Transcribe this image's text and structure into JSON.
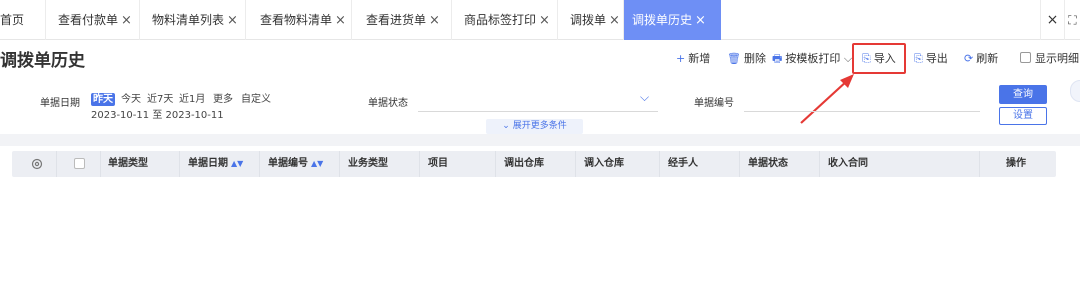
{
  "tabs": [
    {
      "label": "首页",
      "closable": false,
      "active": false
    },
    {
      "label": "查看付款单",
      "closable": true,
      "active": false
    },
    {
      "label": "物料清单列表",
      "closable": true,
      "active": false
    },
    {
      "label": "查看物料清单",
      "closable": true,
      "active": false
    },
    {
      "label": "查看进货单",
      "closable": true,
      "active": false
    },
    {
      "label": "商品标签打印",
      "closable": true,
      "active": false
    },
    {
      "label": "调拨单",
      "closable": true,
      "active": false
    },
    {
      "label": "调拨单历史",
      "closable": true,
      "active": true
    }
  ],
  "tab_close_glyph": "×",
  "tab_close_all": "×",
  "tab_fullscreen": "⛶",
  "page": {
    "title": "调拨单历史"
  },
  "toolbar": {
    "add": {
      "icon": "+",
      "label": "新增"
    },
    "delete": {
      "icon": "🗑",
      "label": "删除"
    },
    "print": {
      "icon": "🖶",
      "label": "按模板打印",
      "caret": "⌵"
    },
    "import": {
      "icon": "⎘",
      "label": "导入"
    },
    "export": {
      "icon": "⎘",
      "label": "导出"
    },
    "refresh": {
      "icon": "⟳",
      "label": "刷新"
    },
    "show_detail": {
      "label": "显示明细",
      "checked": false
    }
  },
  "filters": {
    "date_label": "单据日期",
    "date_quick": [
      "昨天",
      "今天",
      "近7天",
      "近1月",
      "更多",
      "自定义"
    ],
    "date_quick_active": "昨天",
    "date_from": "2023-10-11",
    "date_sep": "至",
    "date_to": "2023-10-11",
    "status_label": "单据状态",
    "status_value": "",
    "number_label": "单据编号",
    "number_value": "",
    "query_button": "查询",
    "reset_button": "设置",
    "expand_more": "⌄ 展开更多条件"
  },
  "table": {
    "columns": [
      {
        "label": "单据类型",
        "sortable": false
      },
      {
        "label": "单据日期",
        "sortable": true
      },
      {
        "label": "单据编号",
        "sortable": true
      },
      {
        "label": "业务类型",
        "sortable": false
      },
      {
        "label": "项目",
        "sortable": false
      },
      {
        "label": "调出仓库",
        "sortable": false
      },
      {
        "label": "调入仓库",
        "sortable": false
      },
      {
        "label": "经手人",
        "sortable": false
      },
      {
        "label": "单据状态",
        "sortable": false
      },
      {
        "label": "收入合同",
        "sortable": false
      },
      {
        "label": "操作",
        "sortable": false
      }
    ],
    "sort_glyph": "▲▼",
    "rows": []
  },
  "colors": {
    "accent": "#4a74e8",
    "active_tab": "#6e8ff5",
    "highlight_box": "#e53935"
  }
}
